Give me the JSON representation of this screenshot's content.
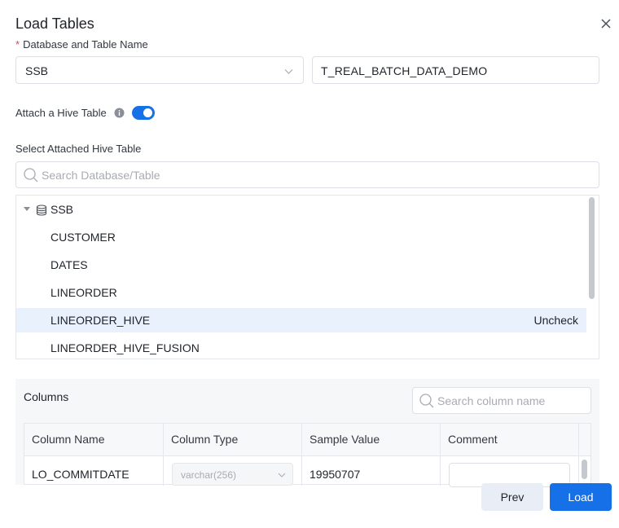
{
  "dialog": {
    "title": "Load Tables"
  },
  "db_table": {
    "required_mark": "*",
    "label": "Database and Table Name",
    "database_value": "SSB",
    "table_value": "T_REAL_BATCH_DATA_DEMO"
  },
  "hive": {
    "attach_label": "Attach a Hive Table",
    "attach_enabled": true,
    "select_label": "Select Attached Hive Table",
    "search_placeholder": "Search Database/Table"
  },
  "tree": {
    "database": "SSB",
    "tables": [
      {
        "name": "CUSTOMER",
        "selected": false
      },
      {
        "name": "DATES",
        "selected": false
      },
      {
        "name": "LINEORDER",
        "selected": false
      },
      {
        "name": "LINEORDER_HIVE",
        "selected": true,
        "action": "Uncheck"
      },
      {
        "name": "LINEORDER_HIVE_FUSION",
        "selected": false
      }
    ]
  },
  "columns": {
    "title": "Columns",
    "search_placeholder": "Search column name",
    "headers": [
      "Column Name",
      "Column Type",
      "Sample Value",
      "Comment"
    ],
    "rows": [
      {
        "name": "LO_COMMITDATE",
        "type": "varchar(256)",
        "sample": "19950707",
        "comment": ""
      }
    ]
  },
  "footer": {
    "prev_label": "Prev",
    "load_label": "Load"
  },
  "colors": {
    "primary": "#1670e8",
    "selected_row": "#e8f1fc",
    "required": "#e5484d"
  }
}
